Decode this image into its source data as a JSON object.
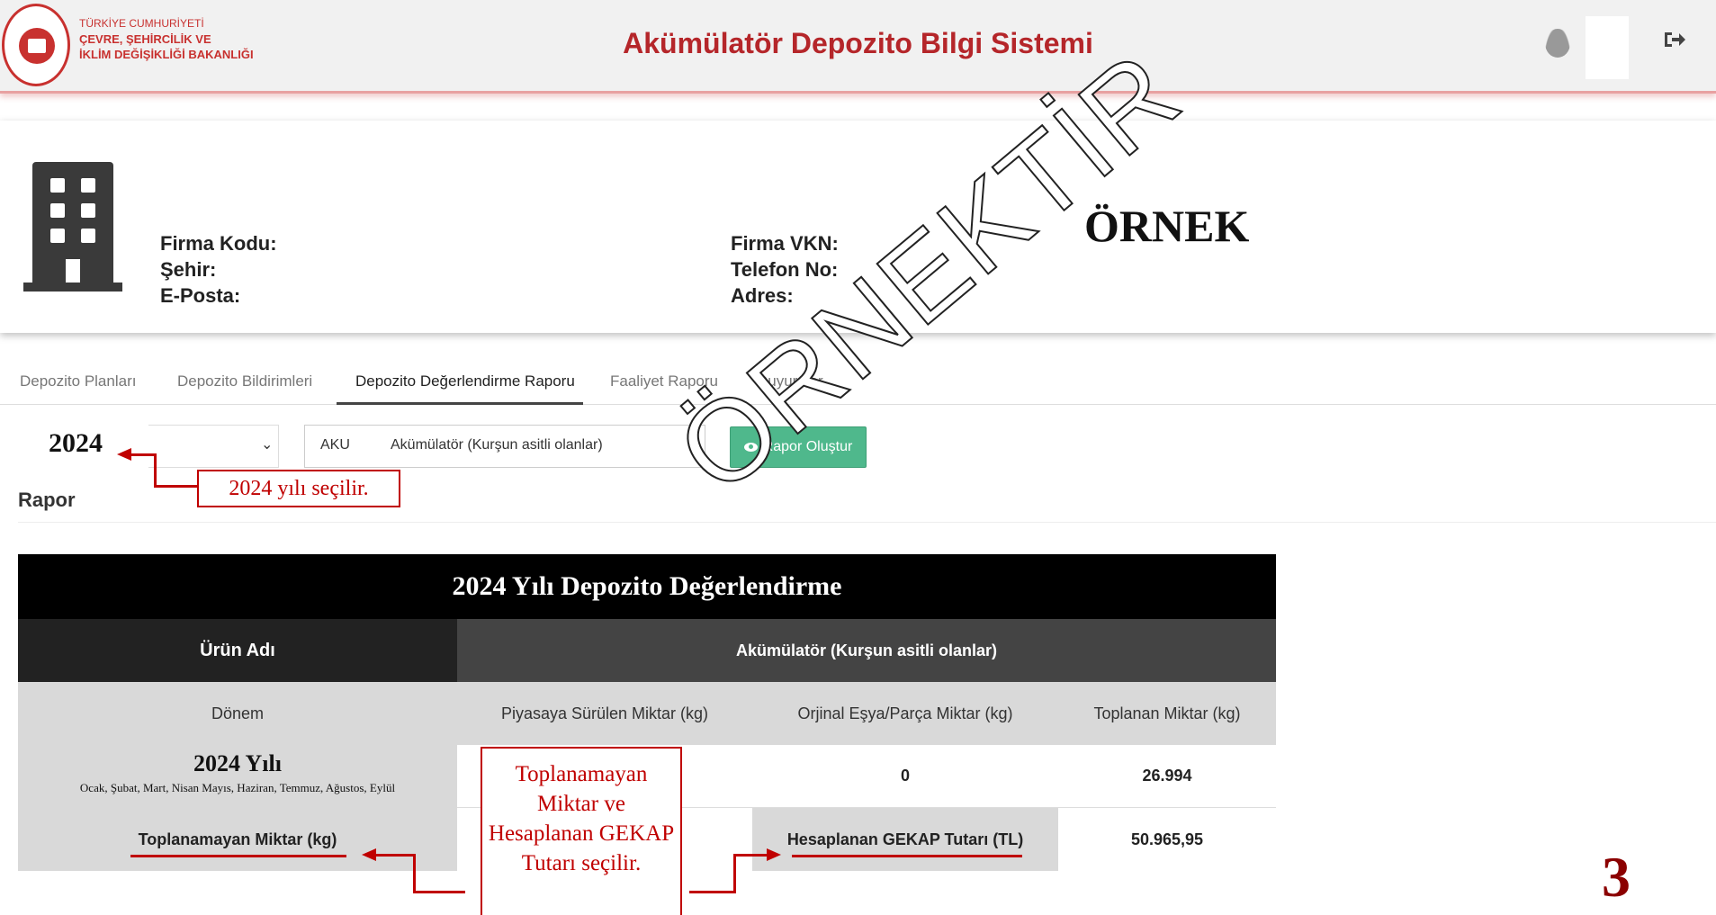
{
  "header": {
    "ministry_lines": [
      "TÜRKİYE CUMHURİYETİ",
      "ÇEVRE, ŞEHİRCİLİK VE",
      "İKLİM DEĞİŞİKLİĞİ BAKANLIĞI"
    ],
    "app_title": "Akümülatör Depozito Bilgi Sistemi",
    "logout_icon": "sign-out"
  },
  "firm": {
    "labels_left": [
      "Firma Kodu:",
      "Şehir:",
      "E-Posta:"
    ],
    "labels_right": [
      "Firma VKN:",
      "Telefon No:",
      "Adres:"
    ],
    "stamp": "ÖRNEK"
  },
  "tabs": [
    {
      "label": "Depozito Planları"
    },
    {
      "label": "Depozito Bildirimleri"
    },
    {
      "label": "Depozito Değerlendirme Raporu"
    },
    {
      "label": "Faaliyet Raporu"
    },
    {
      "label": "Duyurular"
    }
  ],
  "controls": {
    "year_value": "2024",
    "product_code": "AKU",
    "product_name": "Akümülatör (Kurşun asitli olanlar)",
    "report_button": "Rapor Oluştur",
    "rapor_label": "Rapor"
  },
  "table": {
    "title": "2024 Yılı Depozito Değerlendirme",
    "product_header": "Ürün Adı",
    "product_value": "Akümülatör (Kurşun asitli olanlar)",
    "period_header": "Dönem",
    "col_market": "Piyasaya Sürülen Miktar (kg)",
    "col_original": "Orjinal Eşya/Parça Miktar (kg)",
    "col_collected": "Toplanan Miktar (kg)",
    "period_year": "2024 Yılı",
    "period_months": "Ocak, Şubat, Mart, Nisan Mayıs, Haziran, Temmuz, Ağustos, Eylül",
    "original_value": "0",
    "collected_value": "26.994",
    "uncollected_label": "Toplanamayan Miktar (kg)",
    "gekap_label": "Hesaplanan GEKAP Tutarı (TL)",
    "gekap_value": "50.965,95"
  },
  "annotations": {
    "year_note": "2024 yılı seçilir.",
    "center_note": "Toplanamayan Miktar ve Hesaplanan GEKAP Tutarı seçilir."
  },
  "watermark": "ÖRNEKTİR",
  "page_number": "3"
}
